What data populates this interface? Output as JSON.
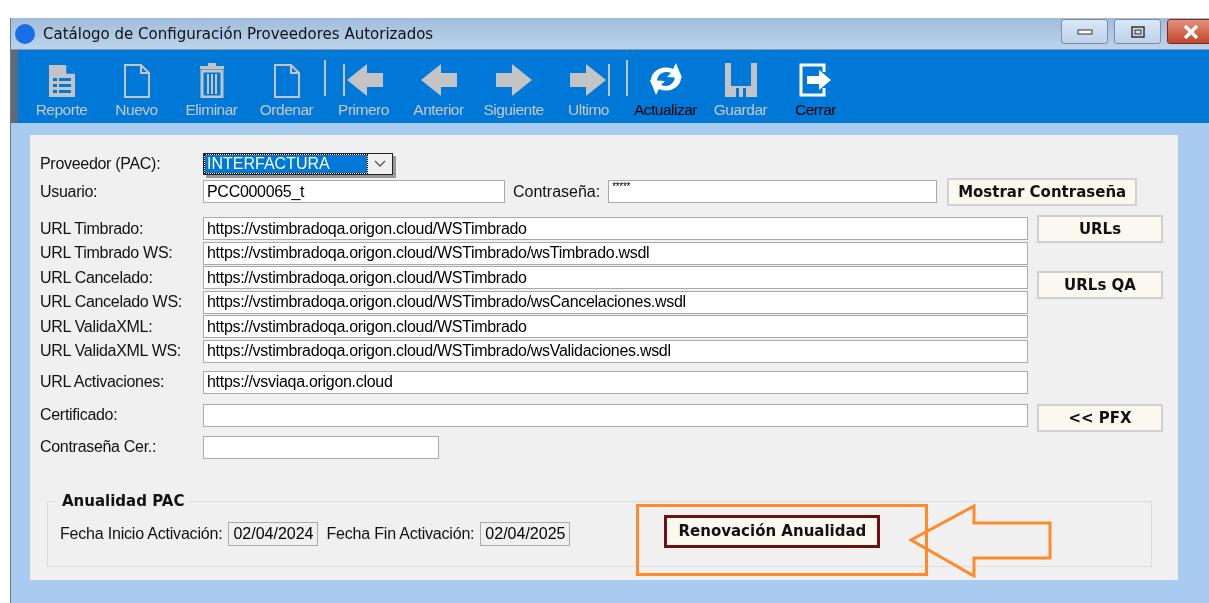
{
  "window": {
    "title": "Catálogo de Configuración Proveedores Autorizados"
  },
  "toolbar": {
    "items": [
      {
        "kind": "report",
        "label": "Reporte",
        "disabled": true
      },
      {
        "kind": "new",
        "label": "Nuevo",
        "disabled": true
      },
      {
        "kind": "delete",
        "label": "Eliminar",
        "disabled": true
      },
      {
        "kind": "order",
        "label": "Ordenar",
        "disabled": true
      },
      {
        "kind": "separator"
      },
      {
        "kind": "first",
        "label": "Primero",
        "disabled": true
      },
      {
        "kind": "prev",
        "label": "Anterior",
        "disabled": true
      },
      {
        "kind": "next",
        "label": "Siguiente",
        "disabled": true
      },
      {
        "kind": "last",
        "label": "Ultimo",
        "disabled": true
      },
      {
        "kind": "separator"
      },
      {
        "kind": "refresh",
        "label": "Actualizar",
        "disabled": false
      },
      {
        "kind": "save",
        "label": "Guardar",
        "disabled": true
      },
      {
        "kind": "close",
        "label": "Cerrar",
        "disabled": false
      }
    ]
  },
  "form": {
    "provider": {
      "label": "Proveedor (PAC):",
      "value": "INTERFACTURA",
      "highlighted": true
    },
    "user": {
      "label": "Usuario:",
      "value": "PCC000065_t"
    },
    "password": {
      "label": "Contraseña:",
      "value": "*****"
    },
    "show_password_button": "Mostrar Contraseña",
    "url_rows": [
      {
        "label": "URL Timbrado:",
        "value": "https://vstimbradoqa.origon.cloud/WSTimbrado",
        "button": "URLs"
      },
      {
        "label": "URL Timbrado WS:",
        "value": "https://vstimbradoqa.origon.cloud/WSTimbrado/wsTimbrado.wsdl"
      },
      {
        "label": "URL Cancelado:",
        "value": "https://vstimbradoqa.origon.cloud/WSTimbrado",
        "button": "URLs QA"
      },
      {
        "label": "URL Cancelado WS:",
        "value": "https://vstimbradoqa.origon.cloud/WSTimbrado/wsCancelaciones.wsdl"
      },
      {
        "label": "URL ValidaXML:",
        "value": "https://vstimbradoqa.origon.cloud/WSTimbrado"
      },
      {
        "label": "URL ValidaXML WS:",
        "value": "https://vstimbradoqa.origon.cloud/WSTimbrado/wsValidaciones.wsdl"
      },
      {
        "label": "URL Activaciones:",
        "value": "https://vsviaqa.origon.cloud"
      }
    ],
    "certificate": {
      "label": "Certificado:",
      "button": "<< PFX"
    },
    "certificate_password": {
      "label": "Contraseña Cer.:"
    }
  },
  "annual_group": {
    "title": "Anualidad PAC",
    "start": {
      "label": "Fecha Inicio Activación:",
      "value": "02/04/2024"
    },
    "end": {
      "label": "Fecha Fin Activación:",
      "value": "02/04/2025"
    },
    "renew_button": {
      "label": "Renovación Anualidad",
      "focused": true
    }
  }
}
